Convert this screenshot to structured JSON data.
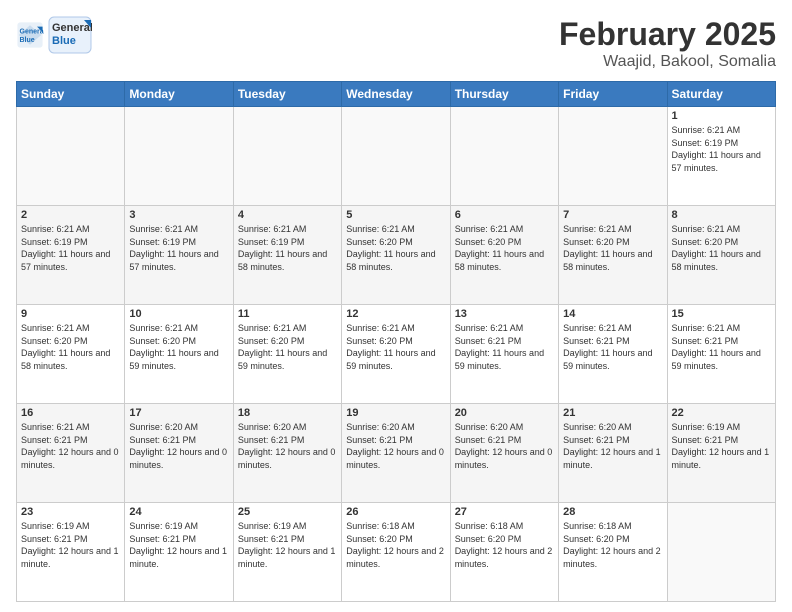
{
  "logo": {
    "line1": "General",
    "line2": "Blue"
  },
  "title": "February 2025",
  "subtitle": "Waajid, Bakool, Somalia",
  "days_of_week": [
    "Sunday",
    "Monday",
    "Tuesday",
    "Wednesday",
    "Thursday",
    "Friday",
    "Saturday"
  ],
  "weeks": [
    [
      {
        "day": "",
        "info": ""
      },
      {
        "day": "",
        "info": ""
      },
      {
        "day": "",
        "info": ""
      },
      {
        "day": "",
        "info": ""
      },
      {
        "day": "",
        "info": ""
      },
      {
        "day": "",
        "info": ""
      },
      {
        "day": "1",
        "info": "Sunrise: 6:21 AM\nSunset: 6:19 PM\nDaylight: 11 hours and 57 minutes."
      }
    ],
    [
      {
        "day": "2",
        "info": "Sunrise: 6:21 AM\nSunset: 6:19 PM\nDaylight: 11 hours and 57 minutes."
      },
      {
        "day": "3",
        "info": "Sunrise: 6:21 AM\nSunset: 6:19 PM\nDaylight: 11 hours and 57 minutes."
      },
      {
        "day": "4",
        "info": "Sunrise: 6:21 AM\nSunset: 6:19 PM\nDaylight: 11 hours and 58 minutes."
      },
      {
        "day": "5",
        "info": "Sunrise: 6:21 AM\nSunset: 6:20 PM\nDaylight: 11 hours and 58 minutes."
      },
      {
        "day": "6",
        "info": "Sunrise: 6:21 AM\nSunset: 6:20 PM\nDaylight: 11 hours and 58 minutes."
      },
      {
        "day": "7",
        "info": "Sunrise: 6:21 AM\nSunset: 6:20 PM\nDaylight: 11 hours and 58 minutes."
      },
      {
        "day": "8",
        "info": "Sunrise: 6:21 AM\nSunset: 6:20 PM\nDaylight: 11 hours and 58 minutes."
      }
    ],
    [
      {
        "day": "9",
        "info": "Sunrise: 6:21 AM\nSunset: 6:20 PM\nDaylight: 11 hours and 58 minutes."
      },
      {
        "day": "10",
        "info": "Sunrise: 6:21 AM\nSunset: 6:20 PM\nDaylight: 11 hours and 59 minutes."
      },
      {
        "day": "11",
        "info": "Sunrise: 6:21 AM\nSunset: 6:20 PM\nDaylight: 11 hours and 59 minutes."
      },
      {
        "day": "12",
        "info": "Sunrise: 6:21 AM\nSunset: 6:20 PM\nDaylight: 11 hours and 59 minutes."
      },
      {
        "day": "13",
        "info": "Sunrise: 6:21 AM\nSunset: 6:21 PM\nDaylight: 11 hours and 59 minutes."
      },
      {
        "day": "14",
        "info": "Sunrise: 6:21 AM\nSunset: 6:21 PM\nDaylight: 11 hours and 59 minutes."
      },
      {
        "day": "15",
        "info": "Sunrise: 6:21 AM\nSunset: 6:21 PM\nDaylight: 11 hours and 59 minutes."
      }
    ],
    [
      {
        "day": "16",
        "info": "Sunrise: 6:21 AM\nSunset: 6:21 PM\nDaylight: 12 hours and 0 minutes."
      },
      {
        "day": "17",
        "info": "Sunrise: 6:20 AM\nSunset: 6:21 PM\nDaylight: 12 hours and 0 minutes."
      },
      {
        "day": "18",
        "info": "Sunrise: 6:20 AM\nSunset: 6:21 PM\nDaylight: 12 hours and 0 minutes."
      },
      {
        "day": "19",
        "info": "Sunrise: 6:20 AM\nSunset: 6:21 PM\nDaylight: 12 hours and 0 minutes."
      },
      {
        "day": "20",
        "info": "Sunrise: 6:20 AM\nSunset: 6:21 PM\nDaylight: 12 hours and 0 minutes."
      },
      {
        "day": "21",
        "info": "Sunrise: 6:20 AM\nSunset: 6:21 PM\nDaylight: 12 hours and 1 minute."
      },
      {
        "day": "22",
        "info": "Sunrise: 6:19 AM\nSunset: 6:21 PM\nDaylight: 12 hours and 1 minute."
      }
    ],
    [
      {
        "day": "23",
        "info": "Sunrise: 6:19 AM\nSunset: 6:21 PM\nDaylight: 12 hours and 1 minute."
      },
      {
        "day": "24",
        "info": "Sunrise: 6:19 AM\nSunset: 6:21 PM\nDaylight: 12 hours and 1 minute."
      },
      {
        "day": "25",
        "info": "Sunrise: 6:19 AM\nSunset: 6:21 PM\nDaylight: 12 hours and 1 minute."
      },
      {
        "day": "26",
        "info": "Sunrise: 6:18 AM\nSunset: 6:20 PM\nDaylight: 12 hours and 2 minutes."
      },
      {
        "day": "27",
        "info": "Sunrise: 6:18 AM\nSunset: 6:20 PM\nDaylight: 12 hours and 2 minutes."
      },
      {
        "day": "28",
        "info": "Sunrise: 6:18 AM\nSunset: 6:20 PM\nDaylight: 12 hours and 2 minutes."
      },
      {
        "day": "",
        "info": ""
      }
    ]
  ]
}
